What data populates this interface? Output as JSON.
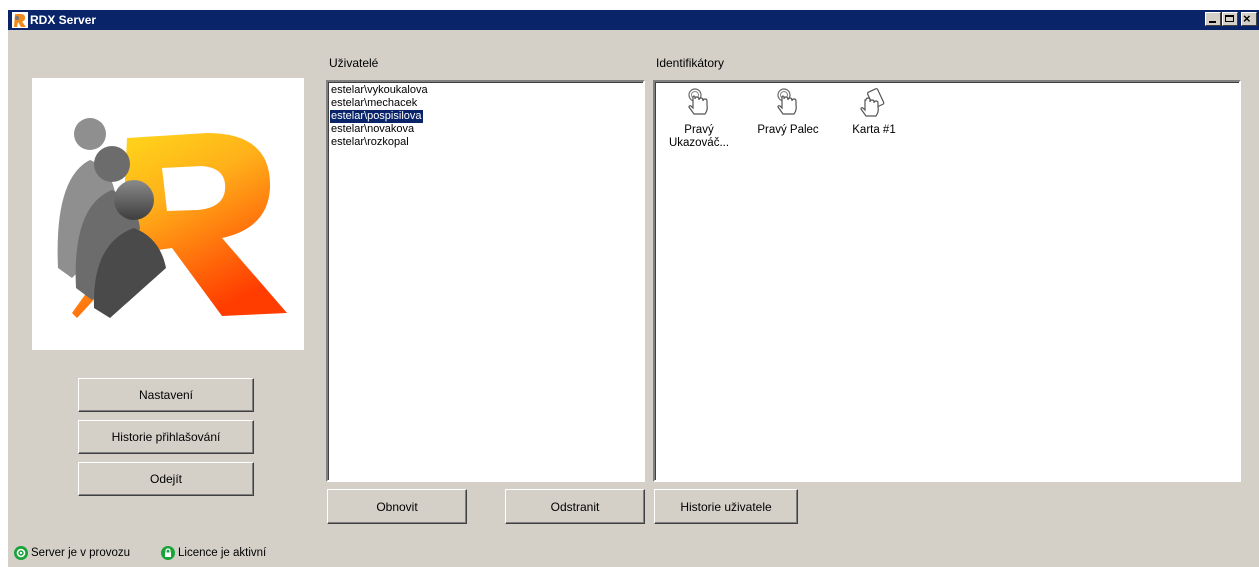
{
  "window": {
    "title": "RDX Server",
    "titlebar_color": "#0a246a"
  },
  "labels": {
    "users": "Uživatelé",
    "identifiers": "Identifikátory"
  },
  "left_buttons": {
    "settings": "Nastavení",
    "login_history": "Historie přihlašování",
    "exit": "Odejít"
  },
  "users": {
    "items": [
      "estelar\\vykoukalova",
      "estelar\\mechacek",
      "estelar\\pospisilova",
      "estelar\\novakova",
      "estelar\\rozkopal"
    ],
    "selected": "estelar\\pospisilova"
  },
  "identifiers": [
    {
      "label": "Pravý Ukazováč...",
      "icon": "fingerprint-touch-icon"
    },
    {
      "label": "Pravý Palec",
      "icon": "fingerprint-touch-icon"
    },
    {
      "label": "Karta #1",
      "icon": "card-touch-icon"
    }
  ],
  "bottom_buttons": {
    "refresh": "Obnovit",
    "remove": "Odstranit",
    "user_history": "Historie uživatele"
  },
  "status": {
    "server": "Server je v provozu",
    "licence": "Licence je aktivní",
    "ok_color": "#1aa33a"
  }
}
